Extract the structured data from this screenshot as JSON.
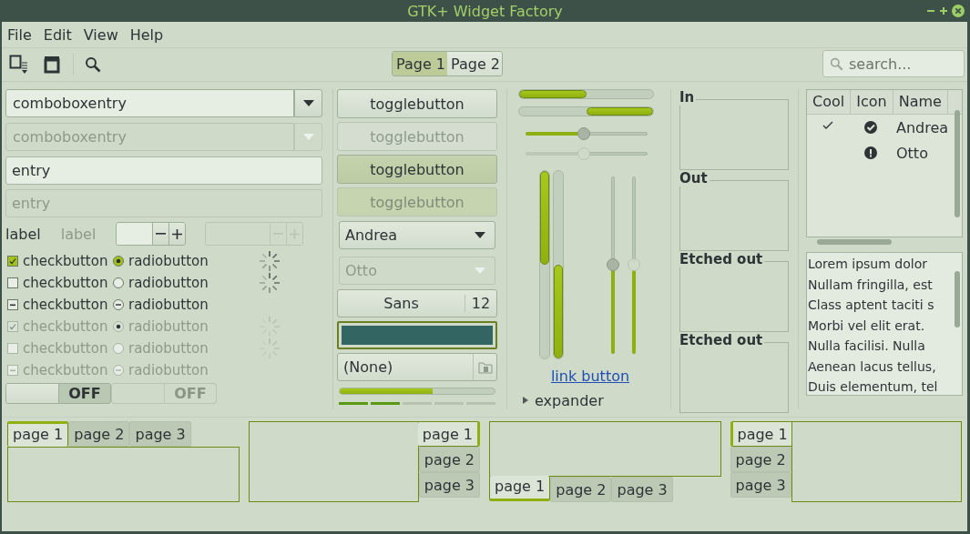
{
  "window": {
    "title": "GTK+ Widget Factory"
  },
  "menu": [
    "File",
    "Edit",
    "View",
    "Help"
  ],
  "toolbar": {
    "stack_switcher": [
      {
        "label": "Page 1",
        "selected": true
      },
      {
        "label": "Page 2",
        "selected": false
      }
    ],
    "search": {
      "placeholder": "search..."
    }
  },
  "combo_entries": [
    {
      "value": "comboboxentry",
      "disabled": false
    },
    {
      "value": "comboboxentry",
      "disabled": true
    }
  ],
  "entries": [
    {
      "value": "entry",
      "disabled": false
    },
    {
      "value": "entry",
      "disabled": true
    }
  ],
  "labels": [
    {
      "text": "label",
      "disabled": false
    },
    {
      "text": "label",
      "disabled": true
    }
  ],
  "spin_buttons": [
    {
      "disabled": false
    },
    {
      "disabled": true
    }
  ],
  "check_rows": [
    {
      "disabled": false,
      "spinner": true,
      "check": {
        "label": "checkbutton",
        "checked": true,
        "inconsistent": false
      },
      "radio": {
        "label": "radiobutton",
        "selected": true,
        "inconsistent": false
      }
    },
    {
      "disabled": false,
      "spinner": true,
      "check": {
        "label": "checkbutton",
        "checked": false,
        "inconsistent": false
      },
      "radio": {
        "label": "radiobutton",
        "selected": false,
        "inconsistent": false
      }
    },
    {
      "disabled": false,
      "spinner": false,
      "check": {
        "label": "checkbutton",
        "checked": false,
        "inconsistent": true
      },
      "radio": {
        "label": "radiobutton",
        "selected": false,
        "inconsistent": true
      }
    },
    {
      "disabled": true,
      "spinner": true,
      "check": {
        "label": "checkbutton",
        "checked": true,
        "inconsistent": false
      },
      "radio": {
        "label": "radiobutton",
        "selected": true,
        "inconsistent": false
      }
    },
    {
      "disabled": true,
      "spinner": true,
      "check": {
        "label": "checkbutton",
        "checked": false,
        "inconsistent": false
      },
      "radio": {
        "label": "radiobutton",
        "selected": false,
        "inconsistent": false
      }
    },
    {
      "disabled": true,
      "spinner": false,
      "check": {
        "label": "checkbutton",
        "checked": false,
        "inconsistent": true
      },
      "radio": {
        "label": "radiobutton",
        "selected": false,
        "inconsistent": true
      }
    }
  ],
  "switches": [
    {
      "label": "OFF",
      "on": false,
      "disabled": false
    },
    {
      "label": "OFF",
      "on": false,
      "disabled": true
    }
  ],
  "toggle_buttons": [
    {
      "label": "togglebutton",
      "active": false,
      "disabled": false
    },
    {
      "label": "togglebutton",
      "active": false,
      "disabled": true
    },
    {
      "label": "togglebutton",
      "active": true,
      "disabled": false
    },
    {
      "label": "togglebutton",
      "active": true,
      "disabled": true
    }
  ],
  "combos": [
    {
      "value": "Andrea",
      "disabled": false
    },
    {
      "value": "Otto",
      "disabled": true
    }
  ],
  "font_button": {
    "family": "Sans",
    "size": "12"
  },
  "color_button": {
    "color": "#336562"
  },
  "file_chooser": {
    "label": "(None)"
  },
  "progress": {
    "level": 0.6
  },
  "level_bar": {
    "level": 0.4
  },
  "progress_bars": [
    {
      "level": 0.5,
      "inverted": false
    },
    {
      "level": 0.5,
      "inverted": true
    }
  ],
  "scales": [
    {
      "level": 0.48,
      "disabled": false
    },
    {
      "level": 0.48,
      "disabled": true
    }
  ],
  "vertical_progress_bars": [
    {
      "level": 0.5,
      "inverted": false
    },
    {
      "level": 0.5,
      "inverted": true
    }
  ],
  "vertical_scales": [
    {
      "level": 0.5,
      "disabled": false
    },
    {
      "level": 0.5,
      "disabled": true
    }
  ],
  "link_button": {
    "label": "link button"
  },
  "expander": {
    "label": "expander",
    "expanded": false
  },
  "frames": [
    {
      "label": "In"
    },
    {
      "label": "Out"
    },
    {
      "label": "Etched out"
    },
    {
      "label": "Etched out"
    }
  ],
  "tree": {
    "columns": [
      "Cool",
      "Icon",
      "Name"
    ],
    "rows": [
      {
        "cool": true,
        "kind": "ok",
        "name": "Andrea"
      },
      {
        "cool": false,
        "kind": "alert",
        "name": "Otto"
      }
    ]
  },
  "text_view": {
    "lines": [
      "Lorem ipsum dolor",
      "Nullam fringilla, est",
      "Class aptent taciti s",
      "Morbi vel elit erat.",
      "Nulla facilisi. Nulla",
      "Aenean lacus tellus,",
      "Duis elementum, tel"
    ]
  },
  "notebooks": [
    {
      "kind": "top",
      "tabs": [
        {
          "label": "page 1",
          "selected": true
        },
        {
          "label": "page 2",
          "selected": false
        },
        {
          "label": "page 3",
          "selected": false
        }
      ]
    },
    {
      "kind": "right",
      "tabs": [
        {
          "label": "page 1",
          "selected": true
        },
        {
          "label": "page 2",
          "selected": false
        },
        {
          "label": "page 3",
          "selected": false
        }
      ]
    },
    {
      "kind": "bottom",
      "tabs": [
        {
          "label": "page 1",
          "selected": true
        },
        {
          "label": "page 2",
          "selected": false
        },
        {
          "label": "page 3",
          "selected": false
        }
      ]
    },
    {
      "kind": "left",
      "tabs": [
        {
          "label": "page 1",
          "selected": true
        },
        {
          "label": "page 2",
          "selected": false
        },
        {
          "label": "page 3",
          "selected": false
        }
      ]
    }
  ]
}
